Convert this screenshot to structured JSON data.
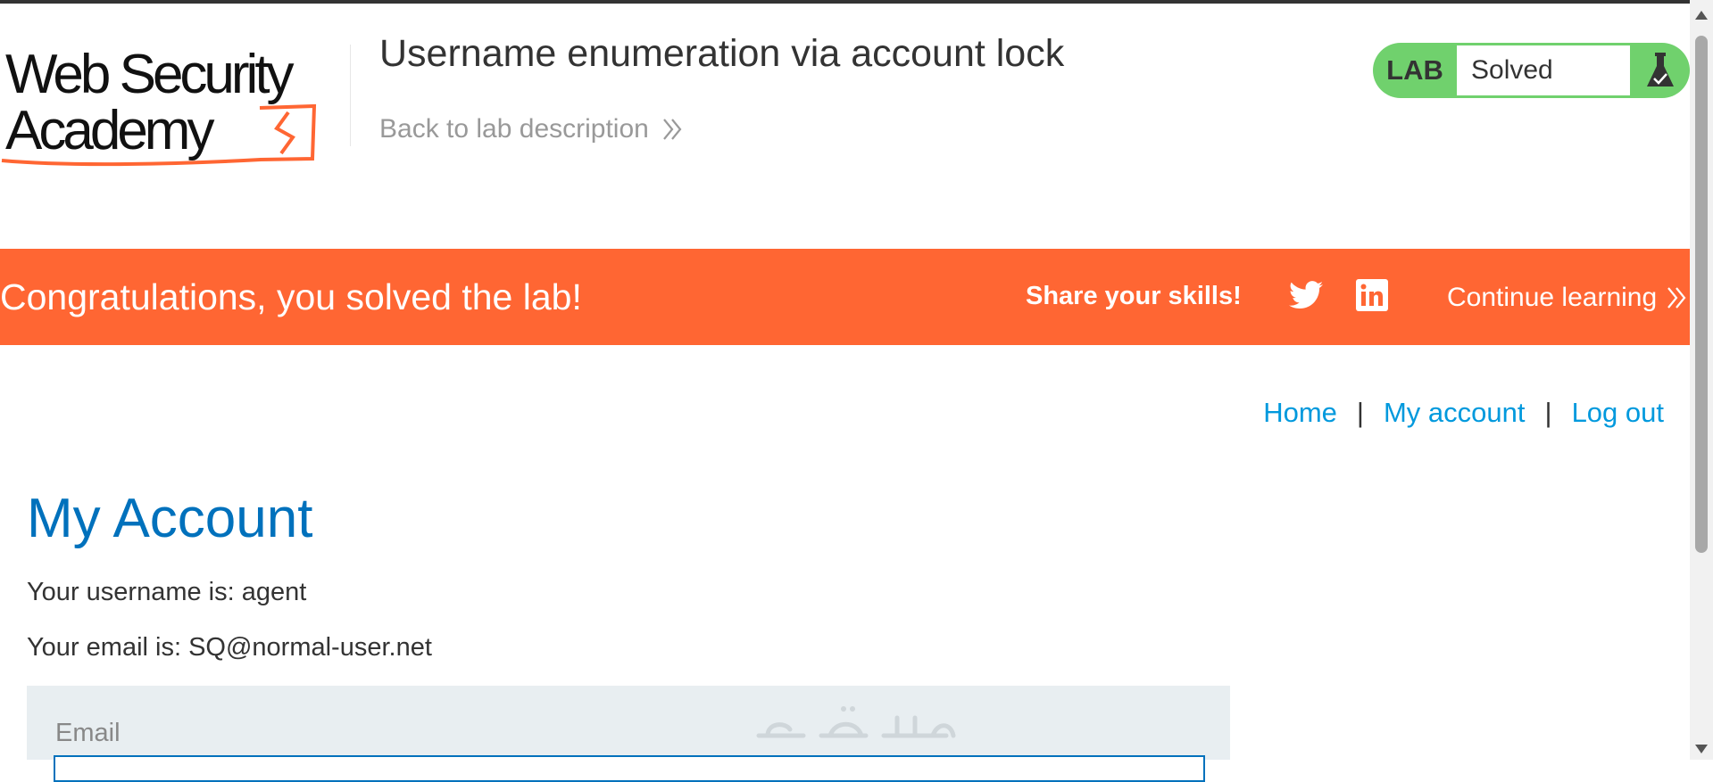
{
  "header": {
    "logo_line1": "Web Security",
    "logo_line2": "Academy",
    "lab_title": "Username enumeration via account lock",
    "back_link": "Back to lab description",
    "badge_label": "LAB",
    "badge_status": "Solved",
    "badge_icon": "flask-check-icon"
  },
  "banner": {
    "message": "Congratulations, you solved the lab!",
    "share_label": "Share your skills!",
    "share_icons": [
      "twitter-icon",
      "linkedin-icon"
    ],
    "continue_link": "Continue learning"
  },
  "nav": {
    "home": "Home",
    "my_account": "My account",
    "log_out": "Log out",
    "separator": "|"
  },
  "account": {
    "title": "My Account",
    "username_text": "Your username is: agent",
    "email_text": "Your email is: SQ@normal-user.net",
    "email_label": "Email",
    "email_value": ""
  },
  "colors": {
    "banner": "#ff6633",
    "badge": "#70d16d",
    "link": "#0099dd",
    "title": "#0071bc",
    "panel": "#e8eef1"
  }
}
